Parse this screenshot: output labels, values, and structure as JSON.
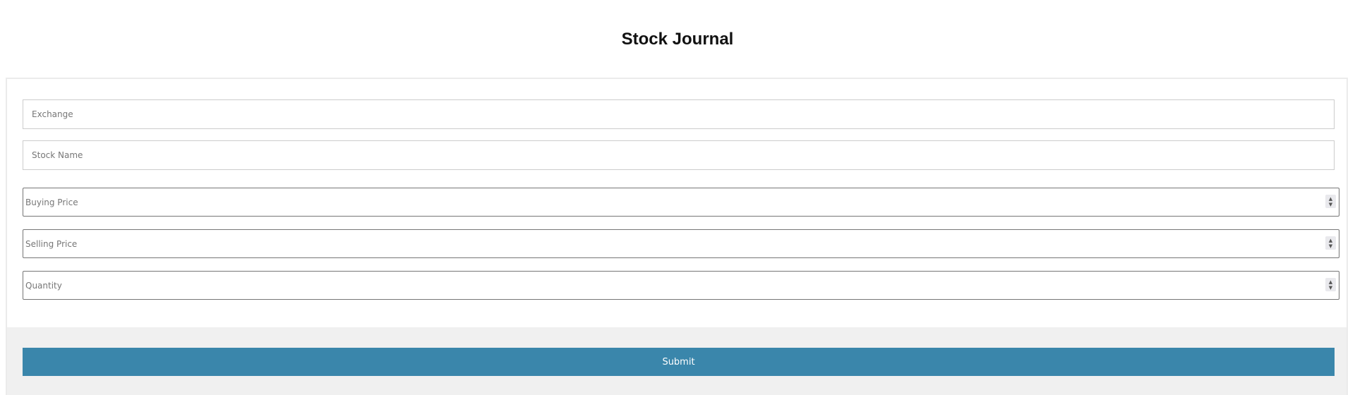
{
  "page": {
    "title": "Stock Journal"
  },
  "form": {
    "exchange": {
      "placeholder": "Exchange",
      "value": ""
    },
    "stock_name": {
      "placeholder": "Stock Name",
      "value": ""
    },
    "buying_price": {
      "placeholder": "Buying Price",
      "value": ""
    },
    "selling_price": {
      "placeholder": "Selling Price",
      "value": ""
    },
    "quantity": {
      "placeholder": "Quantity",
      "value": ""
    },
    "submit_label": "Submit"
  },
  "icons": {
    "spinner": "up-down-spinner-icon"
  },
  "colors": {
    "submit_background": "#3a86ab",
    "footer_background": "#f0f0f0"
  }
}
